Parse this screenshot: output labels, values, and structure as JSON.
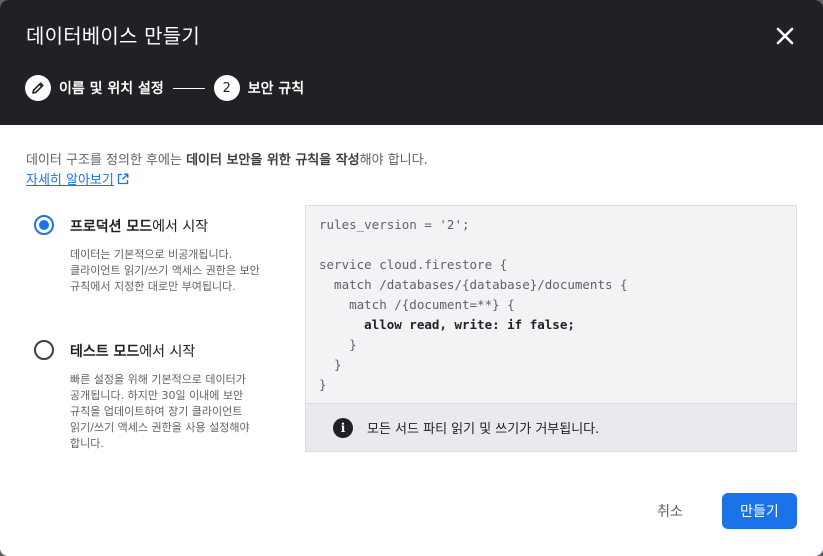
{
  "dialog": {
    "title": "데이터베이스 만들기"
  },
  "stepper": {
    "steps": [
      {
        "index": "",
        "label": "이름 및 위치 설정",
        "state": "completed",
        "icon": "pencil-icon"
      },
      {
        "index": "2",
        "label": "보안 규칙",
        "state": "current"
      }
    ]
  },
  "intro": {
    "text_1": "데이터 구조를 정의한 후에는 ",
    "bold": "데이터 보안을 위한 규칙을 작성",
    "text_2": "해야 합니다.",
    "learn_more": "자세히 알아보기"
  },
  "options": [
    {
      "label_bold": "프로덕션 모드",
      "label_rest": "에서 시작",
      "checked": true,
      "description": "데이터는 기본적으로 비공개됩니다. 클라이언트 읽기/쓰기 액세스 권한은 보안 규칙에서 지정한 대로만 부여됩니다."
    },
    {
      "label_bold": "테스트 모드",
      "label_rest": "에서 시작",
      "checked": false,
      "description": "빠른 설정을 위해 기본적으로 데이터가 공개됩니다. 하지만 30일 이내에 보안 규칙을 업데이트하여 장기 클라이언트 읽기/쓰기 액세스 권한을 사용 설정해야 합니다."
    }
  ],
  "rules": {
    "lines": [
      "rules_version = '2';",
      "",
      "service cloud.firestore {",
      "  match /databases/{database}/documents {",
      "    match /{document=**} {",
      "      allow read, write: if false;",
      "    }",
      "  }",
      "}"
    ],
    "highlight_line": 5,
    "info": "모든 서드 파티 읽기 및 쓰기가 거부됩니다."
  },
  "actions": {
    "cancel": "취소",
    "create": "만들기"
  },
  "colors": {
    "header_bg": "#202124",
    "accent": "#1a73e8",
    "panel_bg": "#f1f3f4",
    "info_bg": "#e8eaed"
  }
}
